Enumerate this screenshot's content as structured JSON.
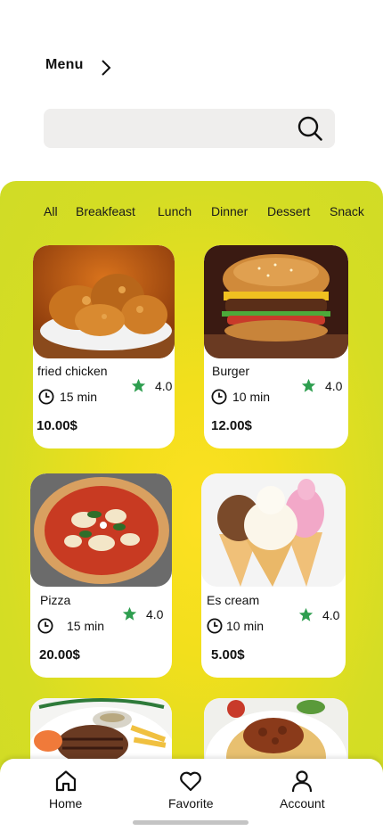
{
  "header": {
    "title": "Menu"
  },
  "search": {
    "placeholder": ""
  },
  "categories": [
    "All",
    "Breakfeast",
    "Lunch",
    "Dinner",
    "Dessert",
    "Snack"
  ],
  "active_category": "All",
  "items": [
    {
      "name": "fried chicken",
      "time": "15 min",
      "rating": "4.0",
      "price": "10.00$",
      "image": "fried-chicken-photo"
    },
    {
      "name": "Burger",
      "time": "10 min",
      "rating": "4.0",
      "price": "12.00$",
      "image": "burger-photo"
    },
    {
      "name": "Pizza",
      "time": "15 min",
      "rating": "4.0",
      "price": "20.00$",
      "image": "pizza-photo"
    },
    {
      "name": "Es cream",
      "time": "10 min",
      "rating": "4.0",
      "price": "5.00$",
      "image": "ice-cream-photo"
    },
    {
      "name": "",
      "time": "",
      "rating": "",
      "price": "",
      "image": "steak-photo"
    },
    {
      "name": "",
      "time": "",
      "rating": "",
      "price": "",
      "image": "spaghetti-photo"
    }
  ],
  "bottom_nav": [
    {
      "label": "Home",
      "icon": "home-icon"
    },
    {
      "label": "Favorite",
      "icon": "heart-icon"
    },
    {
      "label": "Account",
      "icon": "user-icon"
    }
  ],
  "colors": {
    "panel": "#d5dd24",
    "panel_center": "#fde022",
    "star": "#2e9e4f",
    "search_bg": "#efeeed"
  }
}
